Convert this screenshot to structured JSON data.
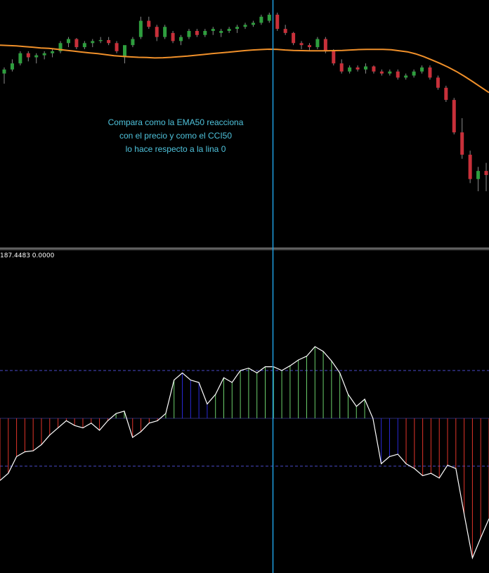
{
  "annotation": {
    "lines": [
      "Compara como la EMA50 reacciona",
      "con el precio y como el CCI50",
      "lo hace respecto a la lina 0"
    ]
  },
  "indicator_readout": "187.4483 0.0000",
  "colors": {
    "background": "#000000",
    "bull_candle": "#2e9e3e",
    "bear_candle": "#c8303a",
    "ema": "#f0902a",
    "cursor_line": "#1e9ee0",
    "separator": "#c8c8c8",
    "level_line": "#4a4ac8",
    "cci_line": "#ffffff",
    "hist_green": "#6ccf6c",
    "hist_blue": "#2a2ad8",
    "hist_red": "#e0342a"
  },
  "chart_data": [
    {
      "type": "candlestick",
      "title": "",
      "overlay": {
        "name": "EMA50",
        "values": [
          34.0,
          33.8,
          33.6,
          33.3,
          33.0,
          32.6,
          32.4,
          32.0,
          31.5,
          31.1,
          30.6,
          30.2,
          29.8,
          29.3,
          28.8,
          28.5,
          28.2,
          28.0,
          27.9,
          27.7,
          27.8,
          28.0,
          28.3,
          28.6,
          29.0,
          29.4,
          29.8,
          30.2,
          30.5,
          30.9,
          31.3,
          31.6,
          31.8,
          32.0,
          31.9,
          31.6,
          31.4,
          31.3,
          31.2,
          31.2,
          31.2,
          31.3,
          31.4,
          31.6,
          31.8,
          31.9,
          31.9,
          31.9,
          31.7,
          31.2,
          30.7,
          29.7,
          28.3,
          26.7,
          25.0,
          23.1,
          21.0,
          18.6,
          16.0,
          13.3,
          10.6
        ]
      },
      "candles": [
        {
          "o": 20.0,
          "h": 23.0,
          "l": 15.0,
          "c": 22.0
        },
        {
          "o": 22.0,
          "h": 27.0,
          "l": 21.0,
          "c": 25.0
        },
        {
          "o": 25.0,
          "h": 31.0,
          "l": 24.0,
          "c": 30.0
        },
        {
          "o": 30.0,
          "h": 31.0,
          "l": 26.0,
          "c": 28.0
        },
        {
          "o": 28.0,
          "h": 30.0,
          "l": 25.0,
          "c": 29.0
        },
        {
          "o": 29.0,
          "h": 31.0,
          "l": 27.0,
          "c": 30.0
        },
        {
          "o": 30.0,
          "h": 32.0,
          "l": 28.0,
          "c": 31.0
        },
        {
          "o": 31.0,
          "h": 36.0,
          "l": 30.0,
          "c": 35.0
        },
        {
          "o": 35.0,
          "h": 38.0,
          "l": 33.0,
          "c": 37.0
        },
        {
          "o": 37.0,
          "h": 37.5,
          "l": 32.0,
          "c": 33.0
        },
        {
          "o": 33.0,
          "h": 36.0,
          "l": 32.0,
          "c": 35.0
        },
        {
          "o": 35.0,
          "h": 37.0,
          "l": 33.0,
          "c": 36.0
        },
        {
          "o": 36.0,
          "h": 38.0,
          "l": 35.0,
          "c": 36.5
        },
        {
          "o": 36.5,
          "h": 38.0,
          "l": 34.0,
          "c": 35.0
        },
        {
          "o": 35.0,
          "h": 36.0,
          "l": 30.0,
          "c": 31.0
        },
        {
          "o": 28.0,
          "h": 32.0,
          "l": 25.0,
          "c": 34.0
        },
        {
          "o": 34.0,
          "h": 38.0,
          "l": 33.0,
          "c": 37.0
        },
        {
          "o": 38.0,
          "h": 48.0,
          "l": 37.0,
          "c": 46.0
        },
        {
          "o": 46.0,
          "h": 48.0,
          "l": 42.0,
          "c": 43.0
        },
        {
          "o": 43.0,
          "h": 44.0,
          "l": 36.0,
          "c": 38.0
        },
        {
          "o": 38.0,
          "h": 44.0,
          "l": 37.0,
          "c": 43.0
        },
        {
          "o": 40.0,
          "h": 41.0,
          "l": 35.0,
          "c": 36.0
        },
        {
          "o": 36.0,
          "h": 39.0,
          "l": 34.0,
          "c": 38.0
        },
        {
          "o": 38.0,
          "h": 42.0,
          "l": 37.0,
          "c": 41.0
        },
        {
          "o": 41.0,
          "h": 42.0,
          "l": 38.0,
          "c": 39.0
        },
        {
          "o": 39.0,
          "h": 42.0,
          "l": 38.0,
          "c": 41.0
        },
        {
          "o": 41.0,
          "h": 43.0,
          "l": 39.0,
          "c": 42.0
        },
        {
          "o": 40.0,
          "h": 42.0,
          "l": 38.0,
          "c": 41.0
        },
        {
          "o": 41.0,
          "h": 43.0,
          "l": 40.0,
          "c": 42.0
        },
        {
          "o": 42.0,
          "h": 44.0,
          "l": 40.0,
          "c": 43.0
        },
        {
          "o": 43.0,
          "h": 45.0,
          "l": 42.0,
          "c": 44.0
        },
        {
          "o": 44.0,
          "h": 46.0,
          "l": 43.0,
          "c": 45.0
        },
        {
          "o": 45.0,
          "h": 49.0,
          "l": 44.0,
          "c": 48.0
        },
        {
          "o": 46.0,
          "h": 50.0,
          "l": 45.0,
          "c": 49.0
        },
        {
          "o": 49.0,
          "h": 50.0,
          "l": 41.0,
          "c": 42.0
        },
        {
          "o": 42.0,
          "h": 44.0,
          "l": 39.0,
          "c": 40.0
        },
        {
          "o": 40.0,
          "h": 40.5,
          "l": 34.0,
          "c": 35.0
        },
        {
          "o": 35.0,
          "h": 36.0,
          "l": 32.0,
          "c": 34.0
        },
        {
          "o": 34.0,
          "h": 35.0,
          "l": 31.0,
          "c": 33.0
        },
        {
          "o": 33.0,
          "h": 38.0,
          "l": 32.0,
          "c": 37.0
        },
        {
          "o": 37.0,
          "h": 38.0,
          "l": 30.0,
          "c": 31.0
        },
        {
          "o": 31.0,
          "h": 32.0,
          "l": 24.0,
          "c": 25.0
        },
        {
          "o": 25.0,
          "h": 27.0,
          "l": 20.0,
          "c": 21.0
        },
        {
          "o": 21.0,
          "h": 24.0,
          "l": 20.0,
          "c": 23.0
        },
        {
          "o": 23.0,
          "h": 24.0,
          "l": 21.0,
          "c": 22.0
        },
        {
          "o": 22.0,
          "h": 25.0,
          "l": 20.0,
          "c": 23.5
        },
        {
          "o": 23.5,
          "h": 24.0,
          "l": 20.0,
          "c": 21.0
        },
        {
          "o": 21.0,
          "h": 22.0,
          "l": 19.0,
          "c": 20.0
        },
        {
          "o": 20.0,
          "h": 22.0,
          "l": 19.0,
          "c": 21.0
        },
        {
          "o": 21.0,
          "h": 22.0,
          "l": 17.0,
          "c": 18.0
        },
        {
          "o": 18.0,
          "h": 20.0,
          "l": 17.0,
          "c": 19.0
        },
        {
          "o": 19.0,
          "h": 22.0,
          "l": 18.0,
          "c": 21.0
        },
        {
          "o": 21.0,
          "h": 24.0,
          "l": 20.0,
          "c": 23.0
        },
        {
          "o": 23.0,
          "h": 24.0,
          "l": 17.0,
          "c": 18.0
        },
        {
          "o": 18.0,
          "h": 19.0,
          "l": 12.0,
          "c": 13.0
        },
        {
          "o": 13.0,
          "h": 14.0,
          "l": 6.0,
          "c": 7.0
        },
        {
          "o": 7.0,
          "h": 8.0,
          "l": -10.0,
          "c": -9.0
        },
        {
          "o": -9.0,
          "h": -2.0,
          "l": -22.0,
          "c": -20.0
        },
        {
          "o": -20.0,
          "h": -18.0,
          "l": -34.0,
          "c": -32.0
        },
        {
          "o": -32.0,
          "h": -26.0,
          "l": -38.0,
          "c": -28.0
        },
        {
          "o": -28.0,
          "h": -24.0,
          "l": -38.0,
          "c": -30.0
        }
      ]
    },
    {
      "type": "histogram",
      "name": "CCI50",
      "title": "",
      "levels": [
        100,
        0,
        -100
      ],
      "ylim": [
        -300,
        150
      ],
      "values": [
        -130,
        -115,
        -80,
        -70,
        -68,
        -55,
        -35,
        -20,
        -5,
        -15,
        -20,
        -10,
        -25,
        -5,
        10,
        15,
        -40,
        -28,
        -10,
        -5,
        10,
        80,
        95,
        80,
        75,
        30,
        50,
        85,
        75,
        100,
        105,
        95,
        108,
        108,
        100,
        110,
        122,
        130,
        150,
        140,
        120,
        95,
        50,
        25,
        40,
        0,
        -95,
        -80,
        -75,
        -95,
        -105,
        -120,
        -115,
        -125,
        -98,
        -105,
        -200,
        -292,
        -250,
        -210
      ]
    }
  ]
}
